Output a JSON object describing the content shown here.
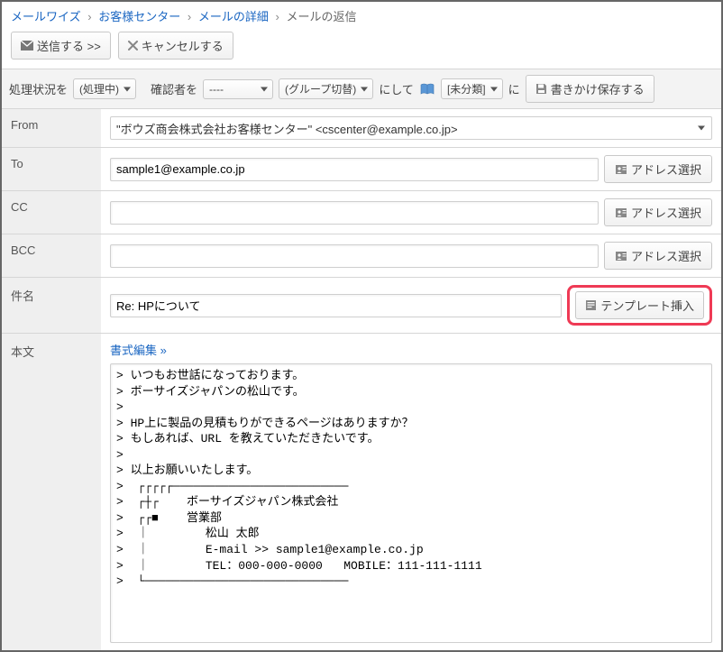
{
  "breadcrumbs": {
    "items": [
      "メールワイズ",
      "お客様センター",
      "メールの詳細"
    ],
    "current": "メールの返信",
    "sep": "›"
  },
  "top_actions": {
    "send": "送信する >>",
    "cancel": "キャンセルする"
  },
  "toolbar": {
    "status_label": "処理状況を",
    "status_value": "(処理中)",
    "confirmer_label": "確認者を",
    "confirmer_value": "----",
    "group_value": "(グループ切替)",
    "to_label": "にして",
    "category_value": "[未分類]",
    "in_label": "に",
    "save_draft": "書きかけ保存する"
  },
  "form": {
    "from": {
      "label": "From",
      "value": "\"ボウズ商会株式会社お客様センター\" <cscenter@example.co.jp>"
    },
    "to": {
      "label": "To",
      "value": "sample1@example.co.jp",
      "addr_btn": "アドレス選択"
    },
    "cc": {
      "label": "CC",
      "value": "",
      "addr_btn": "アドレス選択"
    },
    "bcc": {
      "label": "BCC",
      "value": "",
      "addr_btn": "アドレス選択"
    },
    "subject": {
      "label": "件名",
      "value": "Re: HPについて",
      "template_btn": "テンプレート挿入"
    },
    "body": {
      "label": "本文",
      "format_link": "書式編集 »",
      "text": "> いつもお世話になっております。\n> ボーサイズジャパンの松山です。\n>\n> HP上に製品の見積もりができるページはありますか？\n> もしあれば、URL を教えていただきたいです。\n>\n> 以上お願いいたします。\n>  ┌┌┌┌┌─────────────────────────\n>  ┌┼┌    ボーサイズジャパン株式会社\n>  ┌┌■    営業部\n>  ｜        松山 太郎\n>  ｜        E-mail >> sample1@example.co.jp\n>  ｜        TEL：000-000-0000   MOBILE：111-111-1111\n>  └─────────────────────────────"
    }
  }
}
